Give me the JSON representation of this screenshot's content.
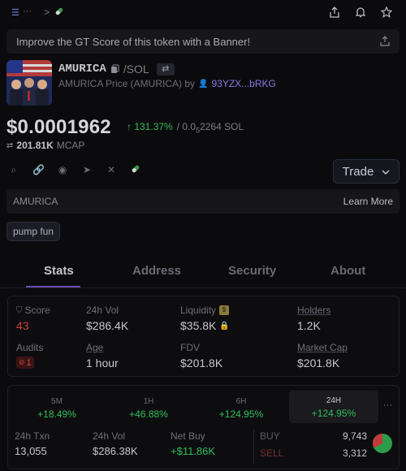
{
  "topbar": {
    "menu_icon": "menu-icon",
    "more": "···",
    "chevron": ">"
  },
  "banner": {
    "text": "Improve the GT Score of this token with a Banner!"
  },
  "token": {
    "symbol": "AMURICA",
    "pair_suffix": "/SOL",
    "subtitle": "AMURICA Price (AMURICA) by",
    "creator": "93YZX...bRKG",
    "price_usd": "$0.0001962",
    "change_pct": "↑ 131.37%",
    "price_sol_prefix": "/ 0.0",
    "price_sol_sub": "5",
    "price_sol_rest": "2264 SOL",
    "mcap": "201.81K",
    "mcap_label": "MCAP"
  },
  "trade": {
    "label": "Trade"
  },
  "infobar": {
    "name": "AMURICA",
    "link": "Learn More"
  },
  "chip": {
    "label": "pump fun"
  },
  "tabs": [
    "Stats",
    "Address",
    "Security",
    "About"
  ],
  "stats": {
    "score_label": "Score",
    "score_value": "43",
    "vol_label": "24h Vol",
    "vol_value": "$286.4K",
    "liq_label": "Liquidity",
    "liq_value": "$35.8K",
    "holders_label": "Holders",
    "holders_value": "1.2K",
    "audits_label": "Audits",
    "audits_value": "1",
    "age_label": "Age",
    "age_value": "1 hour",
    "fdv_label": "FDV",
    "fdv_value": "$201.8K",
    "mcap_label": "Market Cap",
    "mcap_value": "$201.8K"
  },
  "timeframes": [
    {
      "label": "5M",
      "pct": "+18.49%"
    },
    {
      "label": "1H",
      "pct": "+46.88%"
    },
    {
      "label": "6H",
      "pct": "+124.95%"
    },
    {
      "label": "24H",
      "pct": "+124.95%"
    }
  ],
  "txn": {
    "txn_label": "24h Txn",
    "txn_value": "13,055",
    "vol_label": "24h Vol",
    "vol_value": "$286.38K",
    "net_label": "Net Buy",
    "net_value": "+$11.86K",
    "buy_label": "BUY",
    "buy_value": "9,743",
    "sell_label": "SELL",
    "sell_value": "3,312"
  },
  "colors": {
    "accent": "#6b4fb3",
    "green": "#2fbf5a",
    "red": "#d24545"
  }
}
